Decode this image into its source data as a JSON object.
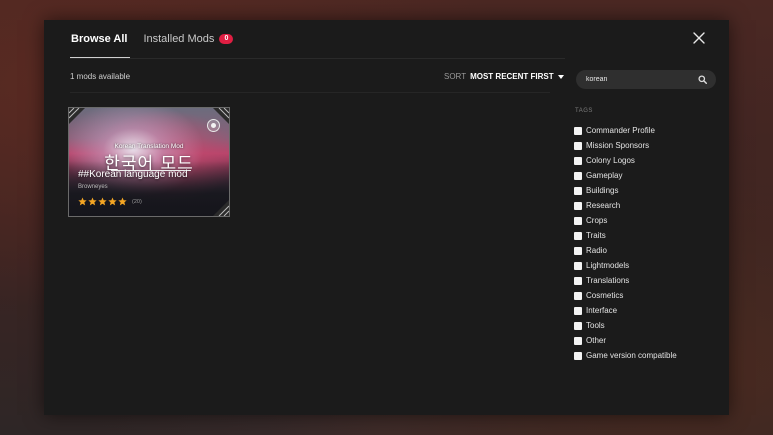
{
  "tabs": [
    {
      "label": "Browse All",
      "active": true
    },
    {
      "label": "Installed Mods",
      "active": false,
      "badge": "0"
    }
  ],
  "header": {
    "count_text": "1 mods available",
    "sort_label": "SORT",
    "sort_value": "MOST RECENT FIRST"
  },
  "search": {
    "value": "korean",
    "icon": "magnifier-icon"
  },
  "mods": [
    {
      "art_title_en": "Korean Translation Mod",
      "art_title_ko": "한국어 모드",
      "title": "##Korean language mod",
      "author": "Browneyes",
      "rating": 5,
      "rating_count": "(20)"
    }
  ],
  "tags": {
    "heading": "TAGS",
    "items": [
      "Commander Profile",
      "Mission Sponsors",
      "Colony Logos",
      "Gameplay",
      "Buildings",
      "Research",
      "Crops",
      "Traits",
      "Radio",
      "Lightmodels",
      "Translations",
      "Cosmetics",
      "Interface",
      "Tools",
      "Other",
      "Game version compatible"
    ]
  },
  "colors": {
    "badge": "#e01e42",
    "star": "#f5a623",
    "panel": "#1b1b1b"
  }
}
